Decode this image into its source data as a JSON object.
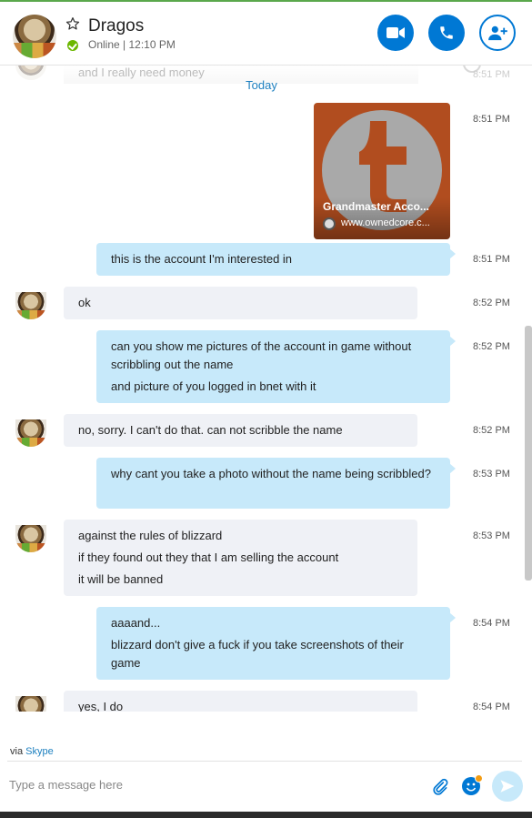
{
  "header": {
    "name": "Dragos",
    "status": "Online  |  12:10 PM"
  },
  "conversation": {
    "faded_prev": "and I really need money",
    "faded_time": "8:51 PM",
    "day_separator": "Today",
    "link_card": {
      "title": "Grandmaster Acco...",
      "url": "www.ownedcore.c...",
      "time": "8:51 PM"
    },
    "messages": [
      {
        "dir": "out",
        "lines": [
          "this is the account I'm interested in"
        ],
        "time": "8:51 PM"
      },
      {
        "dir": "in",
        "lines": [
          "ok"
        ],
        "time": "8:52 PM"
      },
      {
        "dir": "out",
        "lines": [
          "can you show me pictures of the account in game without scribbling out the name",
          "and picture of you logged in bnet with it"
        ],
        "time": "8:52 PM"
      },
      {
        "dir": "in",
        "lines": [
          "no, sorry. I can't do that. can not scribble the name"
        ],
        "time": "8:52 PM"
      },
      {
        "dir": "out",
        "lines": [
          "why cant you take a photo without the name being scribbled?"
        ],
        "time": "8:53 PM"
      },
      {
        "dir": "in",
        "lines": [
          "against the rules of blizzard",
          "if they found out they that I am selling the account",
          "it will be banned"
        ],
        "time": "8:53 PM"
      },
      {
        "dir": "out",
        "lines": [
          "aaaand...",
          "blizzard don't give a fuck if you take screenshots of their game"
        ],
        "time": "8:54 PM"
      },
      {
        "dir": "in",
        "lines": [
          "yes, I do"
        ],
        "time": "8:54 PM"
      }
    ]
  },
  "footer": {
    "via_prefix": "via ",
    "via_link": "Skype",
    "compose_placeholder": "Type a message here"
  },
  "colors": {
    "accent": "#0078d4",
    "outgoing_bubble": "#c7e9fa",
    "incoming_bubble": "#eff1f6",
    "online": "#6bb700"
  },
  "icons": [
    "star-icon",
    "check-icon",
    "video-call-icon",
    "phone-icon",
    "add-person-icon",
    "attach-icon",
    "emoji-icon",
    "send-icon"
  ]
}
